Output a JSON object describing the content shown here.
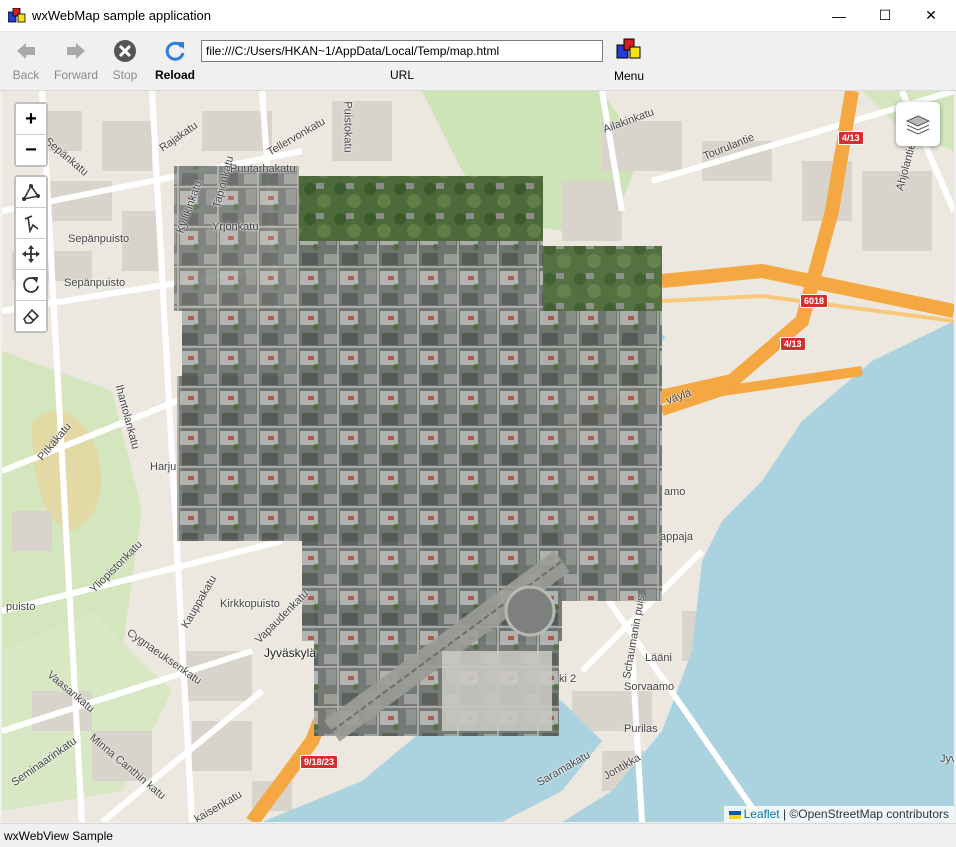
{
  "window": {
    "title": "wxWebMap sample application",
    "minimize_glyph": "—",
    "maximize_glyph": "☐",
    "close_glyph": "✕"
  },
  "toolbar": {
    "back_label": "Back",
    "forward_label": "Forward",
    "stop_label": "Stop",
    "reload_label": "Reload",
    "url_value": "file:///C:/Users/HKAN~1/AppData/Local/Temp/map.html",
    "url_label": "URL",
    "menu_label": "Menu"
  },
  "map": {
    "zoom_in": "+",
    "zoom_out": "−",
    "draw_tools": [
      "polyline-draw-icon",
      "pointer-edit-icon",
      "move-icon",
      "rotate-icon",
      "eraser-icon"
    ],
    "layers_icon": "layers-icon",
    "attribution_link": "Leaflet",
    "attribution_text": "| ©OpenStreetMap contributors",
    "street_labels": {
      "sepankatu": "Sepänkatu",
      "rajakatu": "Rajakatu",
      "puistokatu": "Puistokatu",
      "puutarhakatu": "Puutarhakatu",
      "tellervonkatu": "Tellervonkatu",
      "tapionkatu": "Tapionkatu",
      "kyllikinkatu": "Kyllikinkatu",
      "yrjonkatu": "Yrjönkatu",
      "sepanpuisto1": "Sepänpuisto",
      "sepanpuisto2": "Sepänpuisto",
      "ailakinkatu": "Ailakinkatu",
      "tourulantie": "Tourulantie",
      "ahjolantie": "Ahjolantie",
      "harju": "Harju",
      "kirkkopuisto": "Kirkkopuisto",
      "jyvaskyla": "Jyväskylä",
      "kauppakatu": "Kauppakatu",
      "vapaudenkatu": "Vapaudenkatu",
      "cygnaeuksenkatu": "Cygnaeuksenkatu",
      "vaasankatu": "Vaasankatu",
      "minna": "Minna Canthin katu",
      "seminaarinkatu": "Seminaarinkatu",
      "yliopistonkatu": "Yliopistonkatu",
      "laani": "Lääni",
      "sorvaamo": "Sorvaamo",
      "purilas": "Purilas",
      "jontikka": "Jontikka",
      "saramakatu": "Saramakatu",
      "schaumanin": "Schaumanin puis",
      "kappaja": "appaja",
      "amo": "amo",
      "vayla": "väylä",
      "jyv_right": "Jyv",
      "puisto": "puisto",
      "kaisenkatu": "kaisenkatu",
      "ki2": "ki 2",
      "ihantola": "Ihantolankatu",
      "pitkakatu": "Pitkäkatu"
    },
    "road_shields": {
      "r413a": "4/13",
      "r6018": "6018",
      "r413b": "4/13",
      "r91823": "9/18/23"
    }
  },
  "status": {
    "text": "wxWebView Sample"
  }
}
